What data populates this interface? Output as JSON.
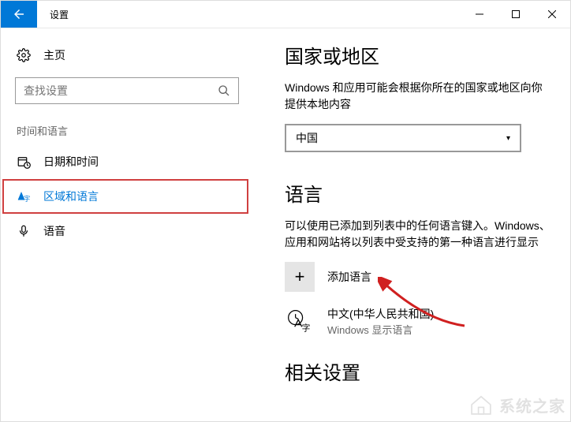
{
  "window": {
    "title": "设置"
  },
  "sidebar": {
    "home": "主页",
    "search_placeholder": "查找设置",
    "section": "时间和语言",
    "items": [
      {
        "label": "日期和时间"
      },
      {
        "label": "区域和语言"
      },
      {
        "label": "语音"
      }
    ]
  },
  "main": {
    "region": {
      "heading": "国家或地区",
      "desc": "Windows 和应用可能会根据你所在的国家或地区向你提供本地内容",
      "selected": "中国"
    },
    "language": {
      "heading": "语言",
      "desc": "可以使用已添加到列表中的任何语言键入。Windows、应用和网站将以列表中受支持的第一种语言进行显示",
      "add_label": "添加语言",
      "items": [
        {
          "name": "中文(中华人民共和国)",
          "sub": "Windows 显示语言"
        }
      ]
    },
    "related": {
      "heading": "相关设置"
    }
  },
  "watermark": "系统之家"
}
